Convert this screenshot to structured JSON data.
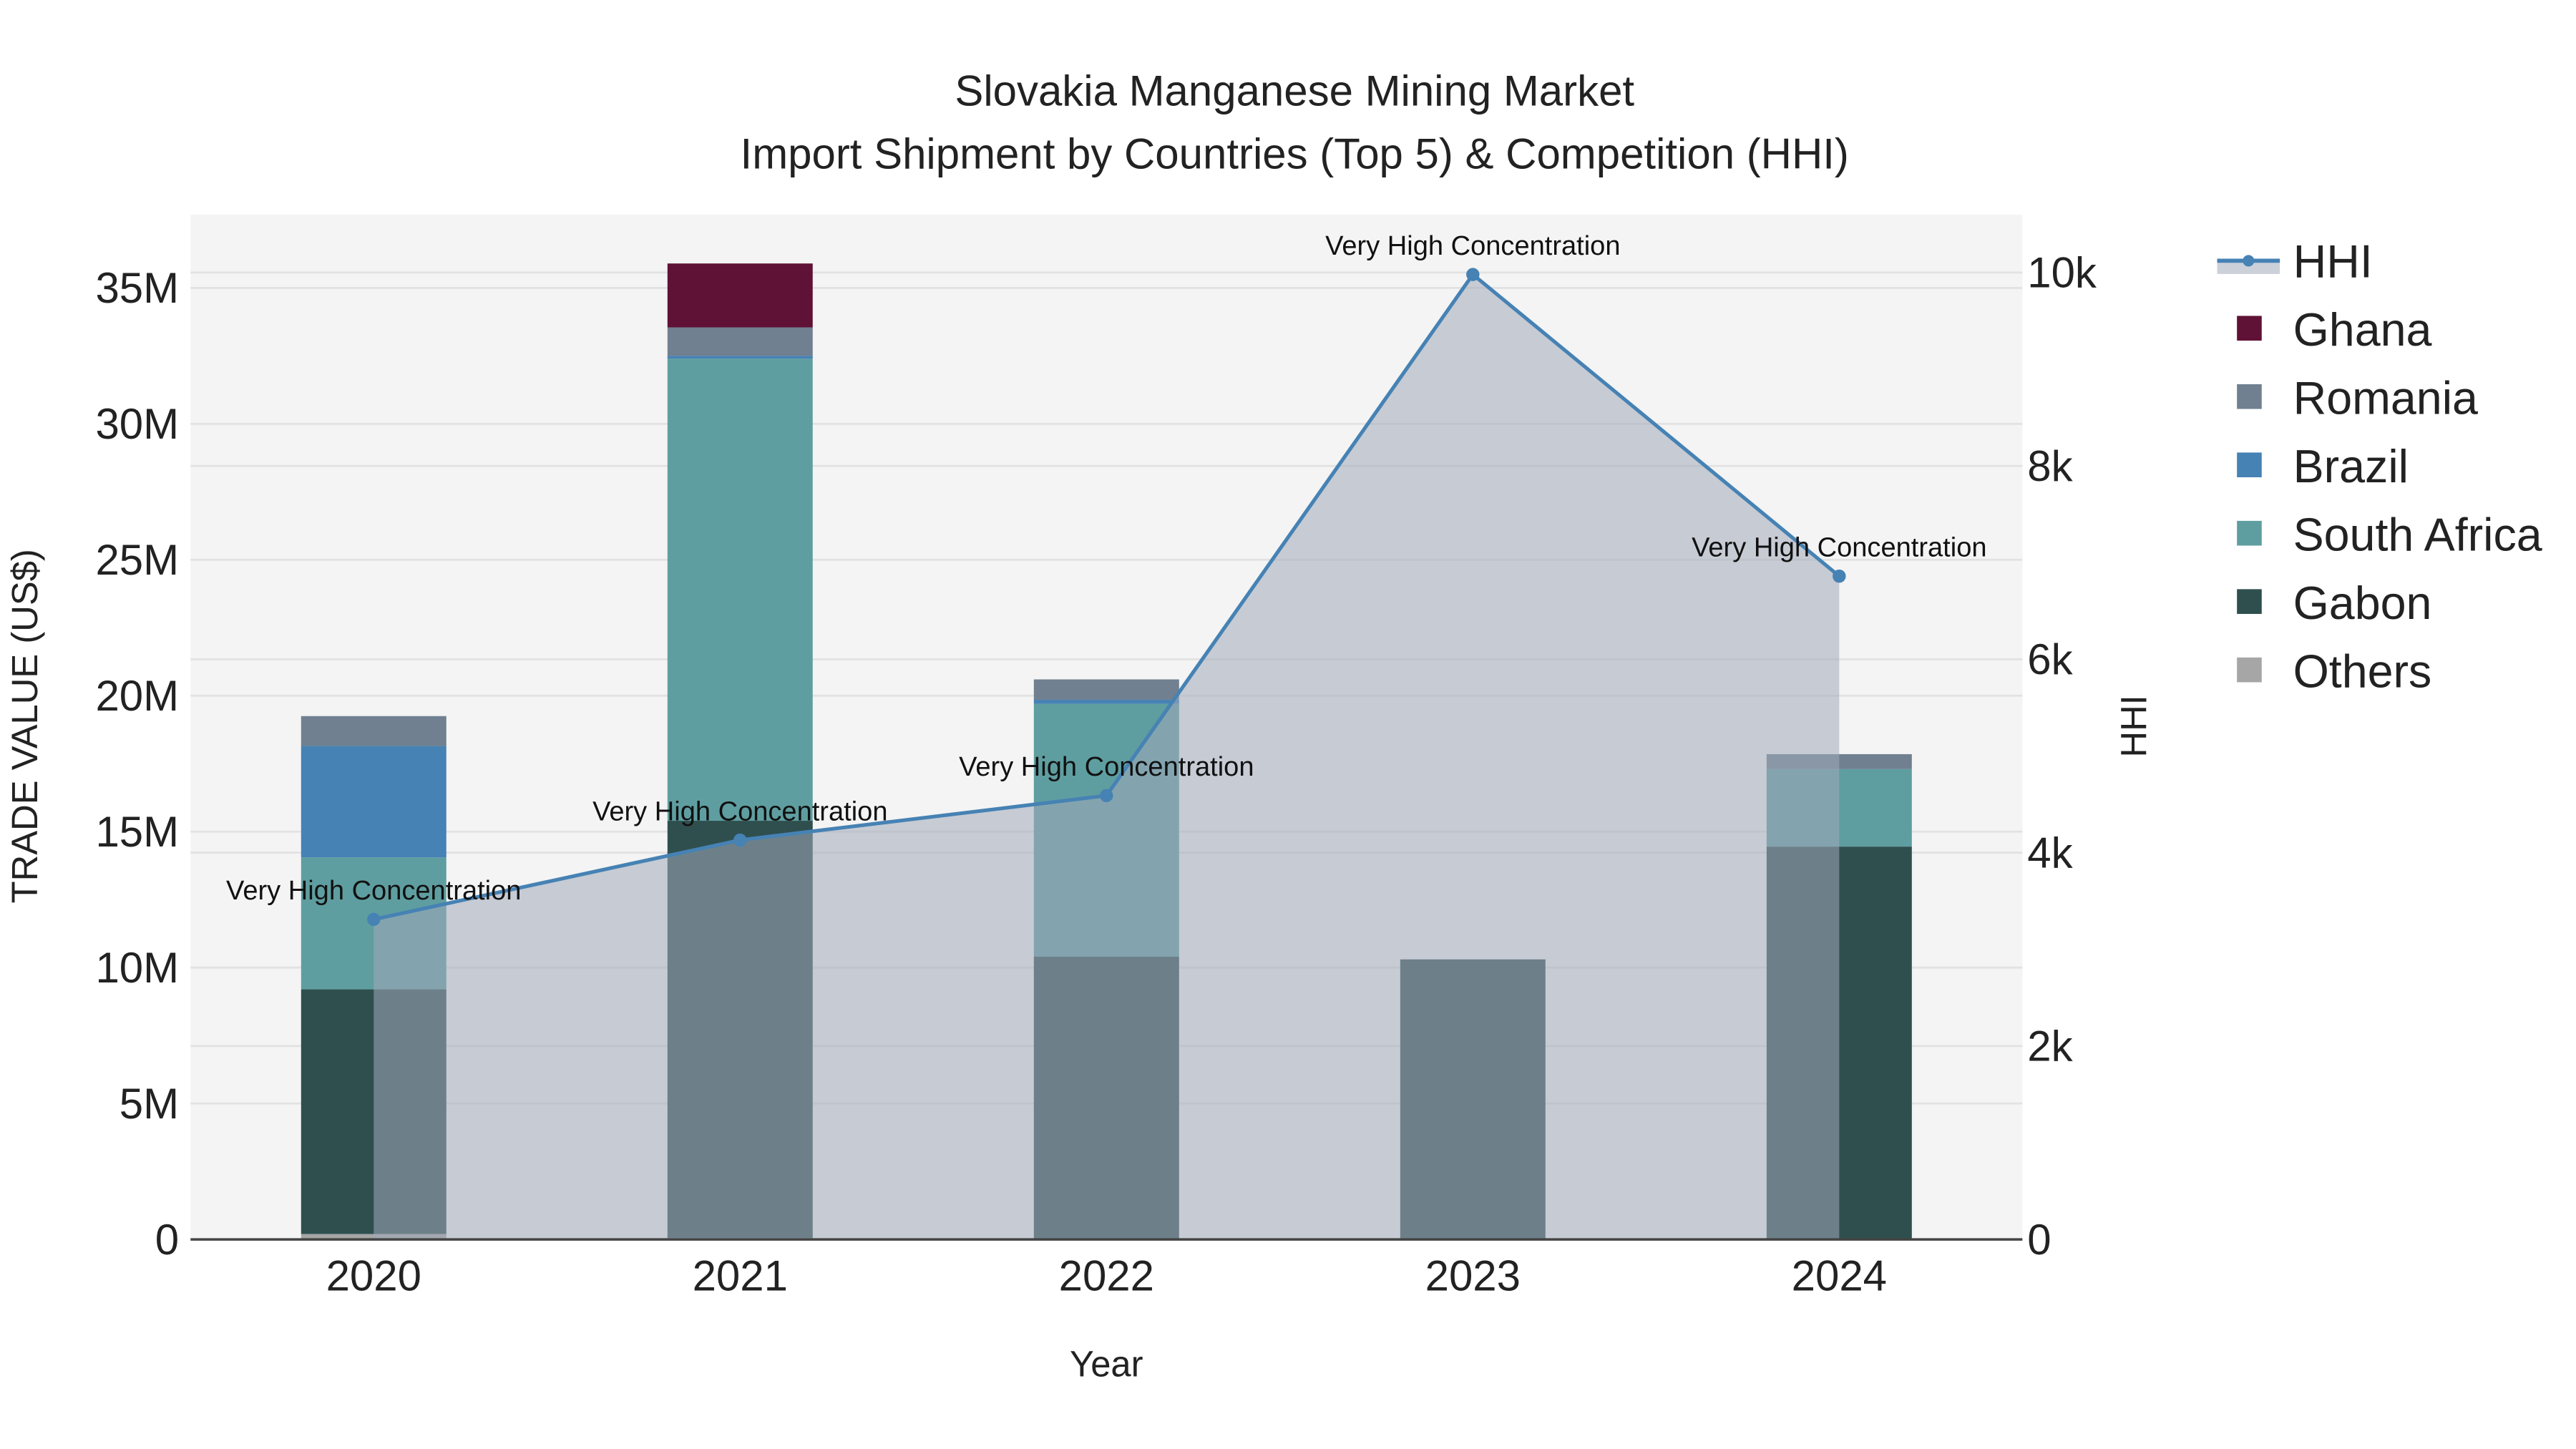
{
  "chart_data": {
    "type": "bar",
    "title": "Slovakia Manganese Mining Market",
    "subtitle": "Import Shipment by Countries (Top 5) & Competition (HHI)",
    "xlabel": "Year",
    "ylabel": "TRADE VALUE (US$)",
    "y2label": "HHI",
    "categories": [
      "2020",
      "2021",
      "2022",
      "2023",
      "2024"
    ],
    "ylim": [
      0,
      37700000
    ],
    "y2lim": [
      0,
      10600
    ],
    "yticks": [
      0,
      5000000,
      10000000,
      15000000,
      20000000,
      25000000,
      30000000,
      35000000
    ],
    "ytick_labels": [
      "0",
      "5M",
      "10M",
      "15M",
      "20M",
      "25M",
      "30M",
      "35M"
    ],
    "y2ticks": [
      0,
      2000,
      4000,
      6000,
      8000,
      10000
    ],
    "y2tick_labels": [
      "0",
      "2k",
      "4k",
      "6k",
      "8k",
      "10k"
    ],
    "grid": true,
    "legend_position": "right",
    "series": [
      {
        "name": "Others",
        "color": "#a6a6a6",
        "values": [
          200000,
          50000,
          0,
          0,
          0
        ]
      },
      {
        "name": "Gabon",
        "color": "#2f4f4f",
        "values": [
          9000000,
          15350000,
          10400000,
          10300000,
          14450000
        ]
      },
      {
        "name": "South Africa",
        "color": "#5f9ea0",
        "values": [
          4850000,
          17000000,
          9300000,
          0,
          2850000
        ]
      },
      {
        "name": "Brazil",
        "color": "#4682b4",
        "values": [
          4100000,
          100000,
          150000,
          0,
          0
        ]
      },
      {
        "name": "Romania",
        "color": "#708090",
        "values": [
          1100000,
          1050000,
          750000,
          0,
          550000
        ]
      },
      {
        "name": "Ghana",
        "color": "#601236",
        "values": [
          0,
          2350000,
          0,
          0,
          0
        ]
      }
    ],
    "hhi": {
      "name": "HHI",
      "color": "#4682b4",
      "values": [
        3310,
        4130,
        4590,
        9980,
        6860
      ],
      "annotations": [
        "Very High Concentration",
        "Very High Concentration",
        "Very High Concentration",
        "Very High Concentration",
        "Very High Concentration"
      ]
    },
    "legend": [
      "HHI",
      "Ghana",
      "Romania",
      "Brazil",
      "South Africa",
      "Gabon",
      "Others"
    ]
  }
}
